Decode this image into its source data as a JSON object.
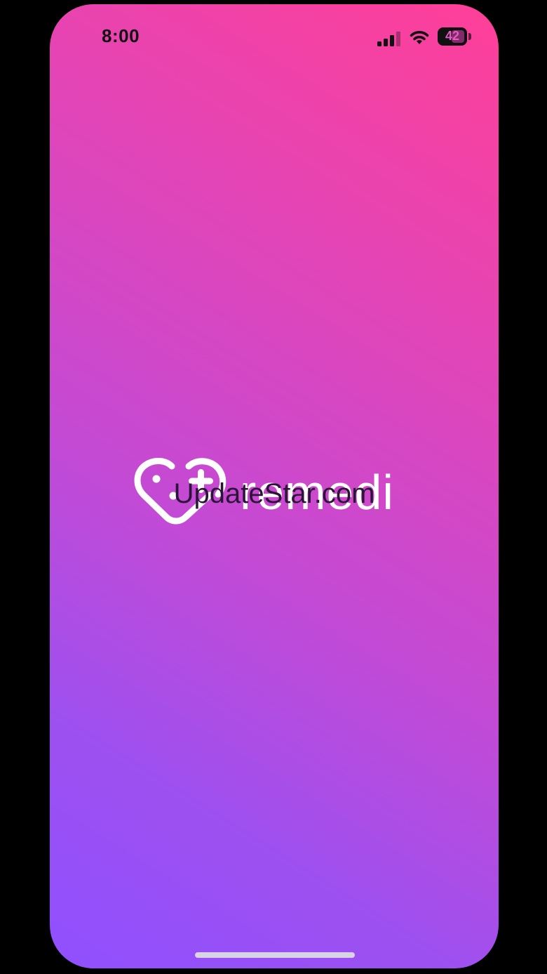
{
  "status_bar": {
    "time": "8:00",
    "battery_level": "42",
    "signal_icon": "cellular-signal-icon",
    "wifi_icon": "wifi-icon",
    "battery_icon": "battery-icon"
  },
  "splash": {
    "logo_icon": "heart-plus-logo-icon",
    "brand_name": "remedi",
    "watermark": "UpdateStar.com"
  },
  "colors": {
    "gradient_top_right": "#ff3f98",
    "gradient_bottom_left": "#9050ff",
    "logo": "#ffffff",
    "status_text": "#111111"
  }
}
